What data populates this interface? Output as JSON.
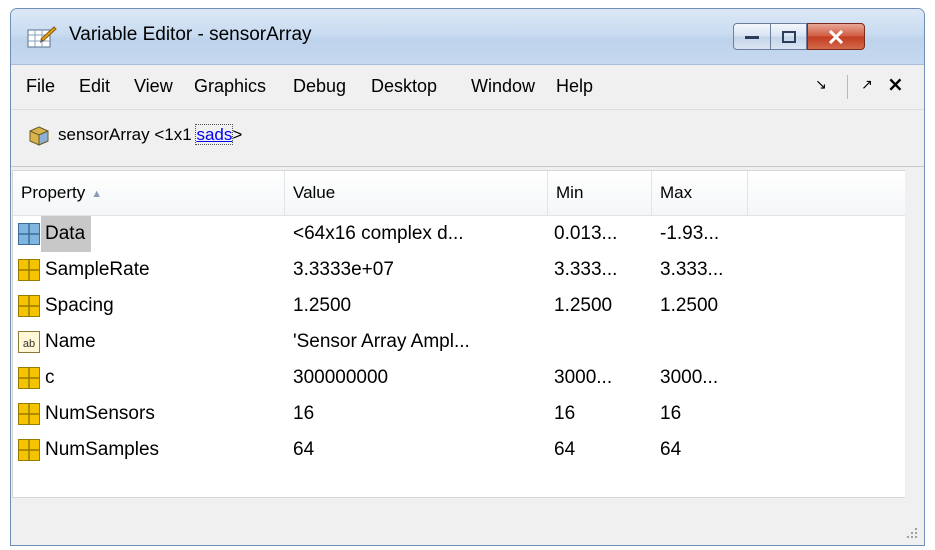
{
  "window": {
    "title": "Variable Editor - sensorArray"
  },
  "menu": {
    "items": [
      "File",
      "Edit",
      "View",
      "Graphics",
      "Debug",
      "Desktop",
      "Window",
      "Help"
    ]
  },
  "breadcrumb": {
    "variable": "sensorArray <1x1 ",
    "class_link": "sads",
    "suffix": ">"
  },
  "table": {
    "columns": [
      "Property",
      "Value",
      "Min",
      "Max"
    ],
    "rows": [
      {
        "icon": "complex-matrix-icon",
        "name": "Data",
        "value": "<64x16 complex d...",
        "min": "0.013...",
        "max": "-1.93..."
      },
      {
        "icon": "numeric-icon",
        "name": "SampleRate",
        "value": "3.3333e+07",
        "min": "3.333...",
        "max": "3.333..."
      },
      {
        "icon": "numeric-icon",
        "name": "Spacing",
        "value": "1.2500",
        "min": "1.2500",
        "max": "1.2500"
      },
      {
        "icon": "char-icon",
        "name": "Name",
        "value": "'Sensor Array Ampl...",
        "min": "",
        "max": ""
      },
      {
        "icon": "numeric-icon",
        "name": "c",
        "value": "300000000",
        "min": "3000...",
        "max": "3000..."
      },
      {
        "icon": "numeric-icon",
        "name": "NumSensors",
        "value": "16",
        "min": "16",
        "max": "16"
      },
      {
        "icon": "numeric-icon",
        "name": "NumSamples",
        "value": "64",
        "min": "64",
        "max": "64"
      }
    ]
  },
  "colors": {
    "grid_icon_yellow": "#f5c400",
    "grid_icon_blue": "#7fb6e0",
    "link": "#0000ee",
    "selected_row": "#c8c8c8"
  }
}
